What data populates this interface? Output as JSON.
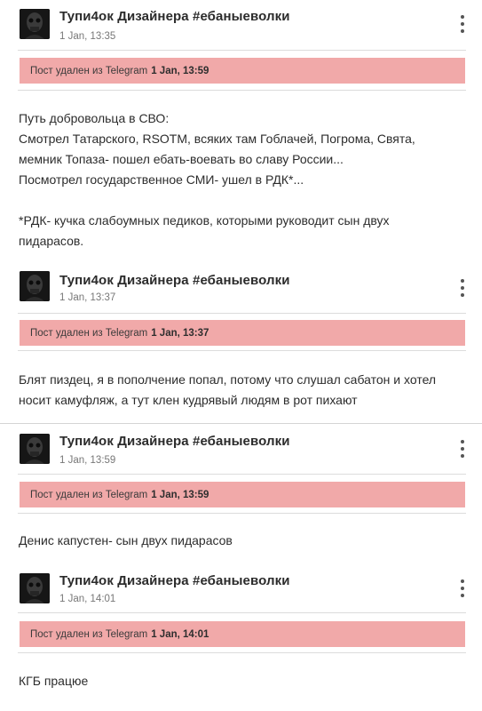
{
  "posts": [
    {
      "author": "Тупи4ок Дизайнера #ебаныеволки",
      "time": "1 Jan, 13:35",
      "banner_prefix": "Пост удален из Telegram",
      "banner_time": "1 Jan, 13:59",
      "lines": [
        "Путь добровольца в СВО:",
        "Смотрел Татарского, RSOTM, всяких там Гоблачей, Погрома, Свята,",
        "мемник Топаза- пошел ебать-воевать во славу России...",
        "Посмотрел государственное СМИ- ушел в РДК*...",
        "",
        "*РДК- кучка слабоумных педиков, которыми руководит сын двух",
        "пидарасов."
      ]
    },
    {
      "author": "Тупи4ок Дизайнера #ебаныеволки",
      "time": "1 Jan, 13:37",
      "banner_prefix": "Пост удален из Telegram",
      "banner_time": "1 Jan, 13:37",
      "lines": [
        "Блят пиздец, я в пополчение попал, потому что слушал сабатон и хотел",
        "носит камуфляж, а тут клен кудрявый людям в рот пихают"
      ]
    },
    {
      "author": "Тупи4ок Дизайнера #ебаныеволки",
      "time": "1 Jan, 13:59",
      "banner_prefix": "Пост удален из Telegram",
      "banner_time": "1 Jan, 13:59",
      "lines": [
        "Денис капустен- сын двух пидарасов"
      ]
    },
    {
      "author": "Тупи4ок Дизайнера #ебаныеволки",
      "time": "1 Jan, 14:01",
      "banner_prefix": "Пост удален из Telegram",
      "banner_time": "1 Jan, 14:01",
      "lines": [
        "КГБ працюе"
      ]
    }
  ],
  "colors": {
    "banner_bg": "#f1a9a9",
    "avatar_bg": "#161616",
    "separator": "#dcdcdc"
  },
  "icons": {
    "menu": "more-vertical-icon",
    "avatar": "avatar-image"
  }
}
